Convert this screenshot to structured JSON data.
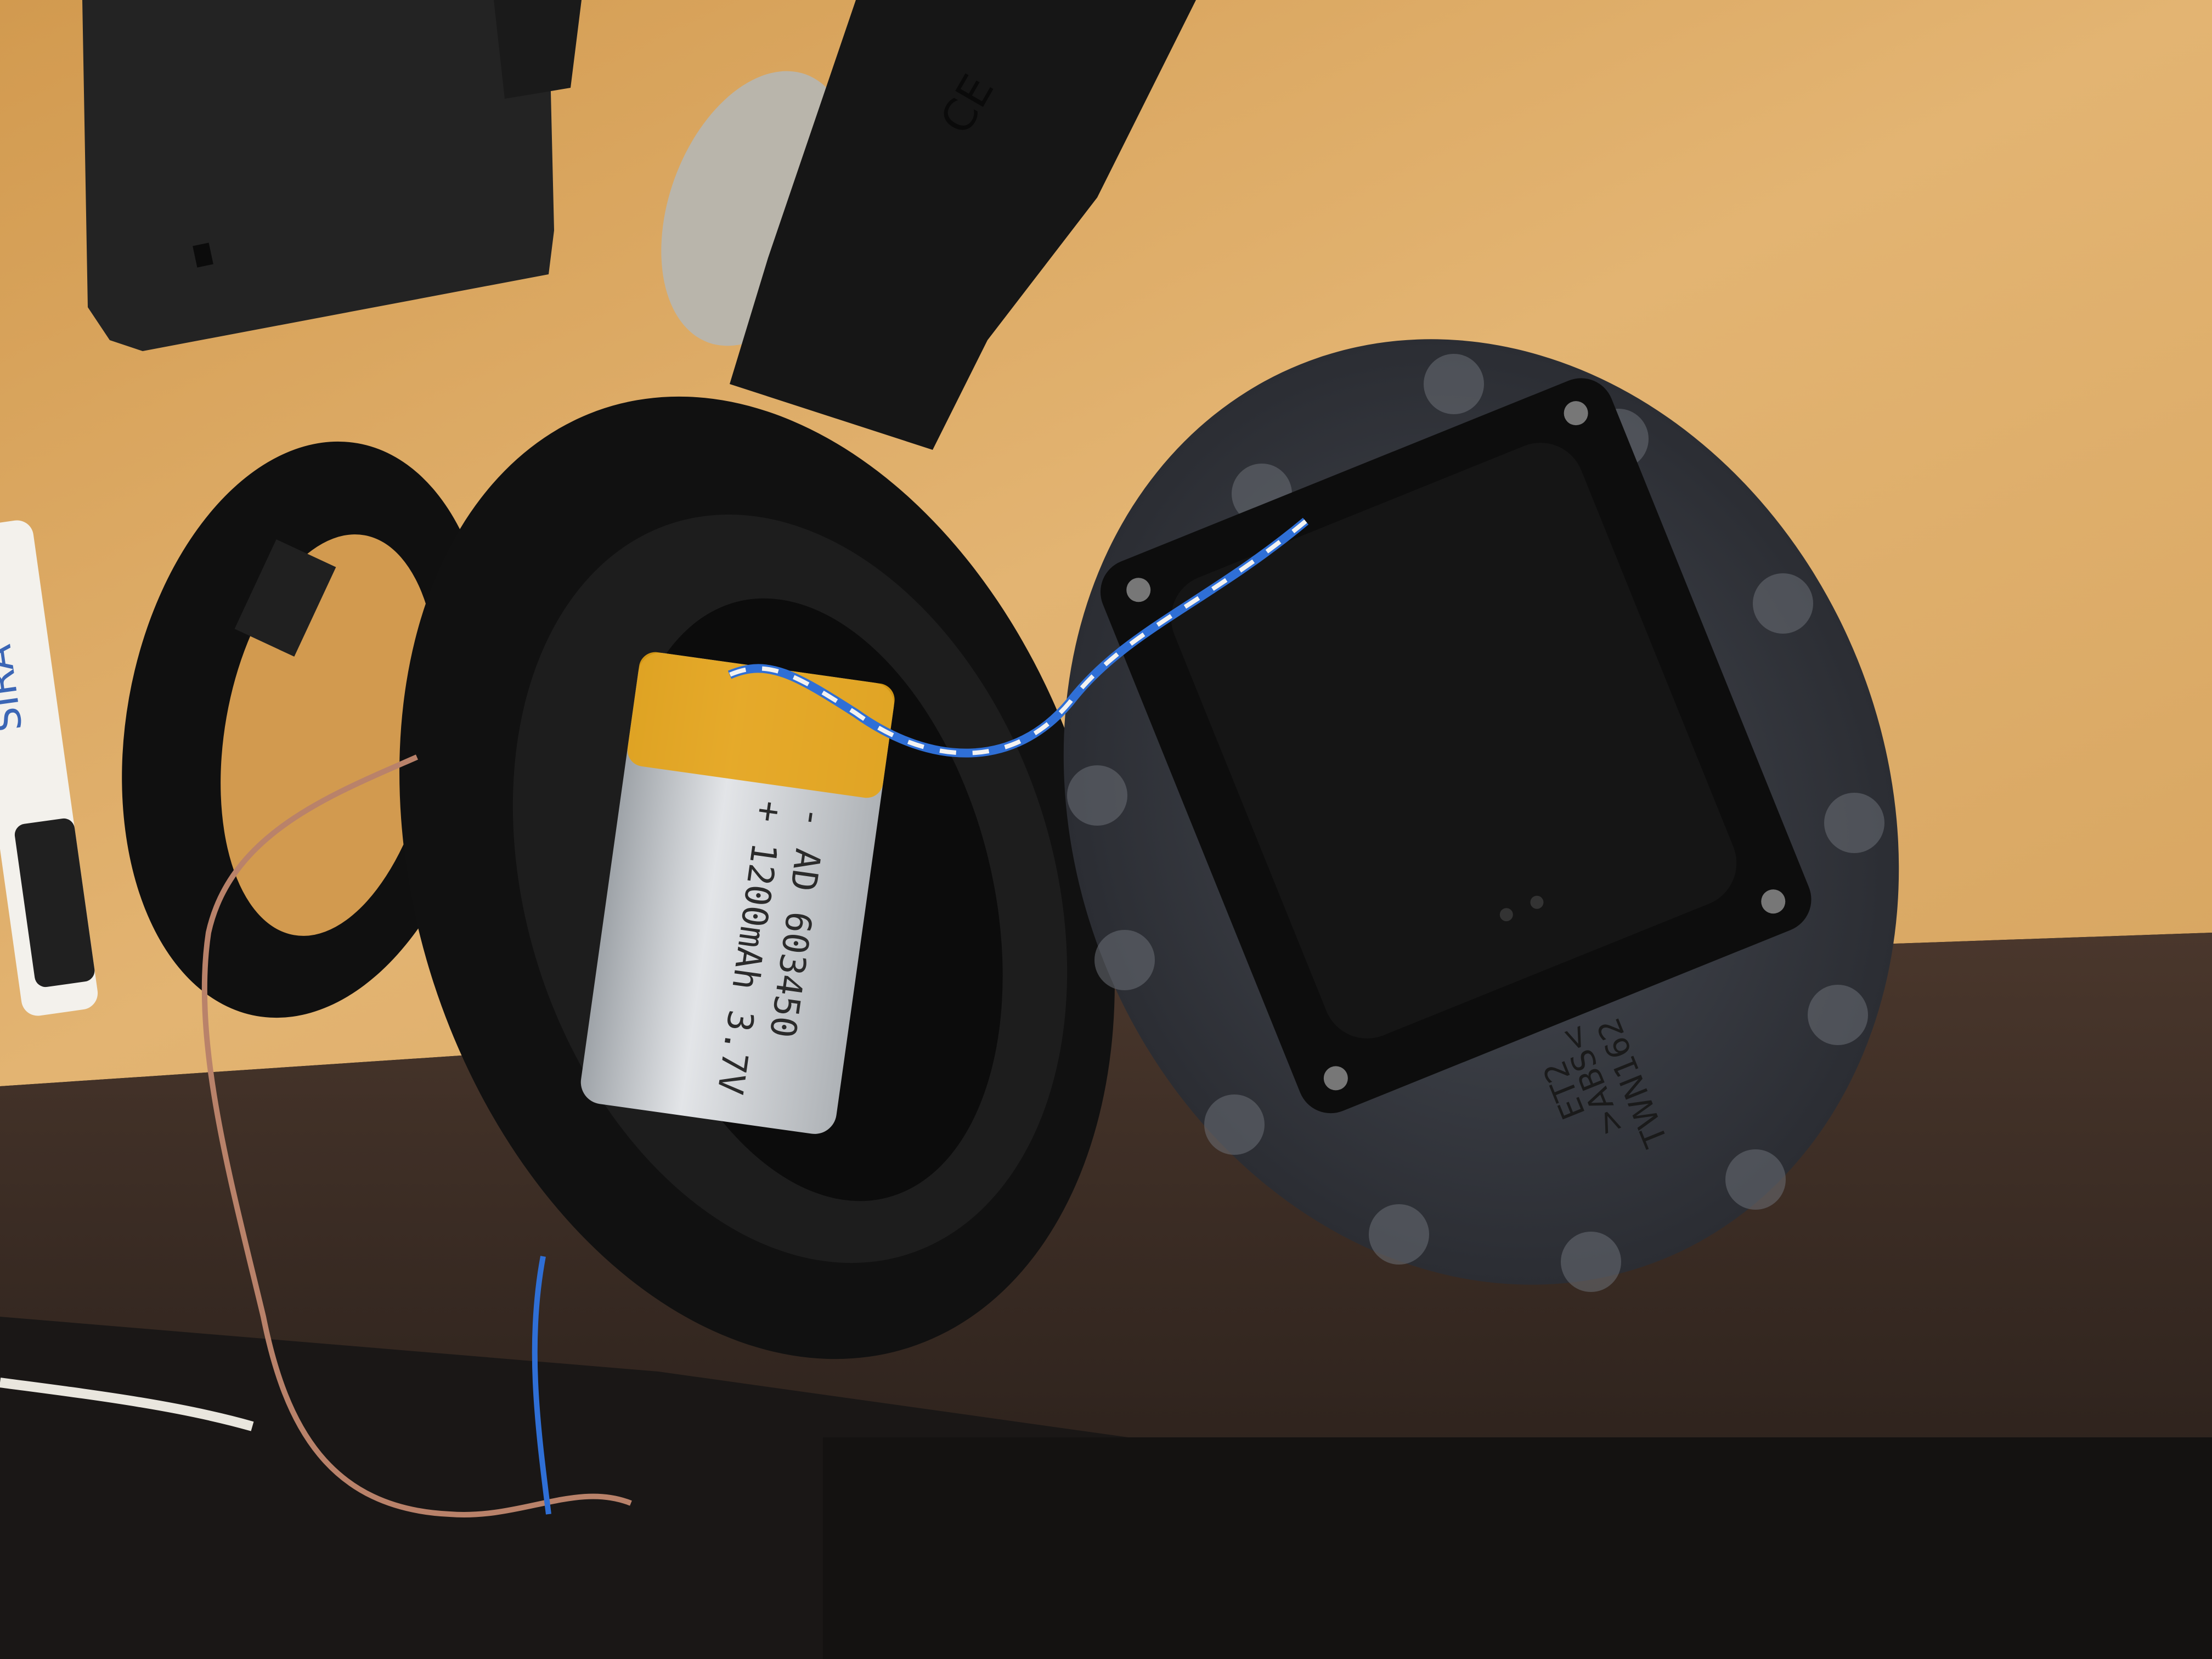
{
  "scene": {
    "subject": "disassembled-headphone-earcup",
    "colors": {
      "wood_desk": "#d9a45a",
      "wood_light": "#e8c184",
      "metal_edge": "#3a2c24",
      "black_plastic": "#151515",
      "battery_silver": "#c9ccd0",
      "kapton_tape": "#e6a315",
      "wire_blue": "#2f6fd6",
      "wire_white": "#f2f2f2",
      "wire_copper": "#b9826a",
      "gray_disc": "#3a3d44"
    }
  },
  "battery": {
    "label_line1": "- AD 603450",
    "label_line2": "+ 1200mAh 3.7V"
  },
  "housing": {
    "mold_text": "TWN162",
    "material_text": ">ABS<",
    "part_code": "ET2"
  },
  "marker": {
    "brand_text": "SIRA"
  },
  "headband": {
    "ce_mark": "CE"
  }
}
